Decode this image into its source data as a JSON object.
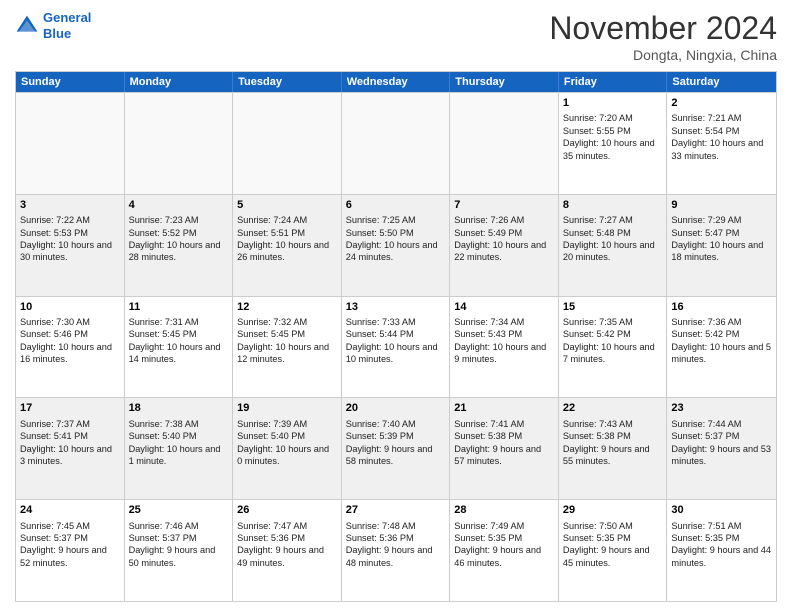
{
  "header": {
    "logo_line1": "General",
    "logo_line2": "Blue",
    "month": "November 2024",
    "location": "Dongta, Ningxia, China"
  },
  "days_of_week": [
    "Sunday",
    "Monday",
    "Tuesday",
    "Wednesday",
    "Thursday",
    "Friday",
    "Saturday"
  ],
  "weeks": [
    [
      {
        "day": "",
        "empty": true
      },
      {
        "day": "",
        "empty": true
      },
      {
        "day": "",
        "empty": true
      },
      {
        "day": "",
        "empty": true
      },
      {
        "day": "",
        "empty": true
      },
      {
        "day": "1",
        "sunrise": "7:20 AM",
        "sunset": "5:55 PM",
        "daylight": "10 hours and 35 minutes."
      },
      {
        "day": "2",
        "sunrise": "7:21 AM",
        "sunset": "5:54 PM",
        "daylight": "10 hours and 33 minutes."
      }
    ],
    [
      {
        "day": "3",
        "sunrise": "7:22 AM",
        "sunset": "5:53 PM",
        "daylight": "10 hours and 30 minutes."
      },
      {
        "day": "4",
        "sunrise": "7:23 AM",
        "sunset": "5:52 PM",
        "daylight": "10 hours and 28 minutes."
      },
      {
        "day": "5",
        "sunrise": "7:24 AM",
        "sunset": "5:51 PM",
        "daylight": "10 hours and 26 minutes."
      },
      {
        "day": "6",
        "sunrise": "7:25 AM",
        "sunset": "5:50 PM",
        "daylight": "10 hours and 24 minutes."
      },
      {
        "day": "7",
        "sunrise": "7:26 AM",
        "sunset": "5:49 PM",
        "daylight": "10 hours and 22 minutes."
      },
      {
        "day": "8",
        "sunrise": "7:27 AM",
        "sunset": "5:48 PM",
        "daylight": "10 hours and 20 minutes."
      },
      {
        "day": "9",
        "sunrise": "7:29 AM",
        "sunset": "5:47 PM",
        "daylight": "10 hours and 18 minutes."
      }
    ],
    [
      {
        "day": "10",
        "sunrise": "7:30 AM",
        "sunset": "5:46 PM",
        "daylight": "10 hours and 16 minutes."
      },
      {
        "day": "11",
        "sunrise": "7:31 AM",
        "sunset": "5:45 PM",
        "daylight": "10 hours and 14 minutes."
      },
      {
        "day": "12",
        "sunrise": "7:32 AM",
        "sunset": "5:45 PM",
        "daylight": "10 hours and 12 minutes."
      },
      {
        "day": "13",
        "sunrise": "7:33 AM",
        "sunset": "5:44 PM",
        "daylight": "10 hours and 10 minutes."
      },
      {
        "day": "14",
        "sunrise": "7:34 AM",
        "sunset": "5:43 PM",
        "daylight": "10 hours and 9 minutes."
      },
      {
        "day": "15",
        "sunrise": "7:35 AM",
        "sunset": "5:42 PM",
        "daylight": "10 hours and 7 minutes."
      },
      {
        "day": "16",
        "sunrise": "7:36 AM",
        "sunset": "5:42 PM",
        "daylight": "10 hours and 5 minutes."
      }
    ],
    [
      {
        "day": "17",
        "sunrise": "7:37 AM",
        "sunset": "5:41 PM",
        "daylight": "10 hours and 3 minutes."
      },
      {
        "day": "18",
        "sunrise": "7:38 AM",
        "sunset": "5:40 PM",
        "daylight": "10 hours and 1 minute."
      },
      {
        "day": "19",
        "sunrise": "7:39 AM",
        "sunset": "5:40 PM",
        "daylight": "10 hours and 0 minutes."
      },
      {
        "day": "20",
        "sunrise": "7:40 AM",
        "sunset": "5:39 PM",
        "daylight": "9 hours and 58 minutes."
      },
      {
        "day": "21",
        "sunrise": "7:41 AM",
        "sunset": "5:38 PM",
        "daylight": "9 hours and 57 minutes."
      },
      {
        "day": "22",
        "sunrise": "7:43 AM",
        "sunset": "5:38 PM",
        "daylight": "9 hours and 55 minutes."
      },
      {
        "day": "23",
        "sunrise": "7:44 AM",
        "sunset": "5:37 PM",
        "daylight": "9 hours and 53 minutes."
      }
    ],
    [
      {
        "day": "24",
        "sunrise": "7:45 AM",
        "sunset": "5:37 PM",
        "daylight": "9 hours and 52 minutes."
      },
      {
        "day": "25",
        "sunrise": "7:46 AM",
        "sunset": "5:37 PM",
        "daylight": "9 hours and 50 minutes."
      },
      {
        "day": "26",
        "sunrise": "7:47 AM",
        "sunset": "5:36 PM",
        "daylight": "9 hours and 49 minutes."
      },
      {
        "day": "27",
        "sunrise": "7:48 AM",
        "sunset": "5:36 PM",
        "daylight": "9 hours and 48 minutes."
      },
      {
        "day": "28",
        "sunrise": "7:49 AM",
        "sunset": "5:35 PM",
        "daylight": "9 hours and 46 minutes."
      },
      {
        "day": "29",
        "sunrise": "7:50 AM",
        "sunset": "5:35 PM",
        "daylight": "9 hours and 45 minutes."
      },
      {
        "day": "30",
        "sunrise": "7:51 AM",
        "sunset": "5:35 PM",
        "daylight": "9 hours and 44 minutes."
      }
    ]
  ]
}
